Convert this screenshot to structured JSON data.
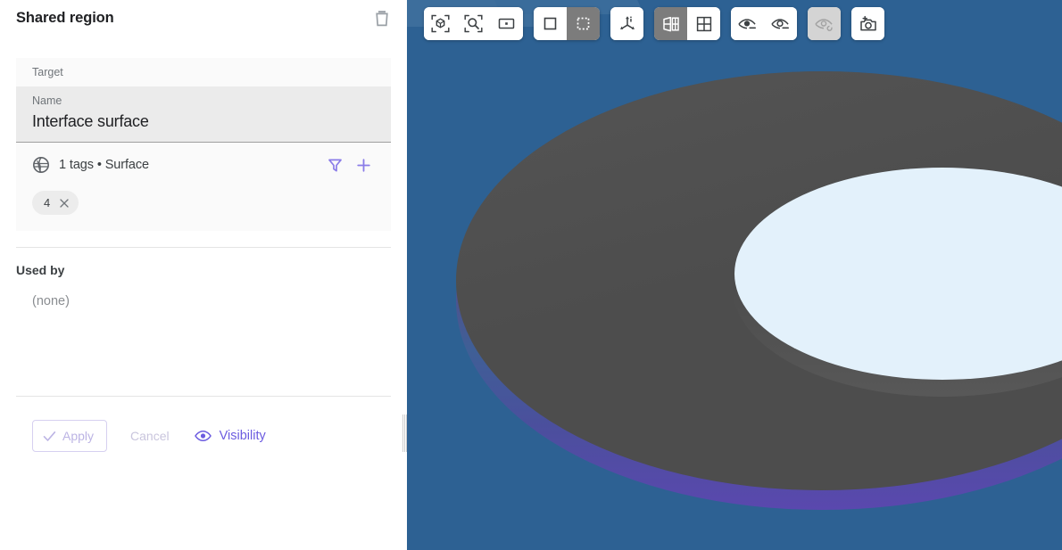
{
  "panel": {
    "title": "Shared region",
    "delete_icon": "trash-icon",
    "target_label": "Target",
    "name_caption": "Name",
    "name_value": "Interface surface",
    "tags": {
      "scope_icon": "globe-icon",
      "summary": "1 tags • Surface",
      "filter_icon": "filter-icon",
      "add_icon": "plus-icon",
      "chips": [
        {
          "label": "4",
          "remove_icon": "close-icon"
        }
      ]
    },
    "used_by": {
      "title": "Used by",
      "value": "(none)"
    },
    "footer": {
      "apply_label": "Apply",
      "apply_icon": "check-icon",
      "apply_disabled": true,
      "cancel_label": "Cancel",
      "cancel_disabled": true,
      "visibility_label": "Visibility",
      "visibility_icon": "eye-icon"
    },
    "resizer": "panel-resize-handle"
  },
  "viewport": {
    "background_color": "#2d6193",
    "model": {
      "top_face_color": "#4d4d4d",
      "rim_color": "#5b49b0",
      "inner_surface_color": "#e3f1fb",
      "inner_wall_color": "#454545"
    },
    "toolbar": {
      "groups": [
        {
          "name": "zoom-group",
          "buttons": [
            {
              "icon": "zoom-fit-all-icon",
              "state": "normal"
            },
            {
              "icon": "zoom-to-selection-icon",
              "state": "normal"
            },
            {
              "icon": "zoom-window-icon",
              "state": "normal"
            }
          ]
        },
        {
          "name": "selection-mode-group",
          "buttons": [
            {
              "icon": "select-box-icon",
              "state": "normal"
            },
            {
              "icon": "select-marquee-icon",
              "state": "active"
            }
          ]
        },
        {
          "name": "orientation-group",
          "buttons": [
            {
              "icon": "axes-triad-icon",
              "state": "normal"
            }
          ]
        },
        {
          "name": "layout-group",
          "buttons": [
            {
              "icon": "split-view-icon",
              "state": "active"
            },
            {
              "icon": "quad-view-icon",
              "state": "normal"
            }
          ]
        },
        {
          "name": "visibility-group",
          "buttons": [
            {
              "icon": "eye-show-icon",
              "state": "normal"
            },
            {
              "icon": "eye-hide-icon",
              "state": "normal"
            }
          ]
        },
        {
          "name": "reset-visibility-group",
          "buttons": [
            {
              "icon": "eye-reset-icon",
              "state": "disabled"
            }
          ]
        },
        {
          "name": "capture-group",
          "buttons": [
            {
              "icon": "camera-add-icon",
              "state": "normal"
            }
          ]
        }
      ]
    }
  },
  "colors": {
    "accent_purple": "#6c5ce0",
    "accent_purple_light": "#8a7ce8",
    "text_primary": "#202124",
    "text_secondary": "#70757a"
  }
}
